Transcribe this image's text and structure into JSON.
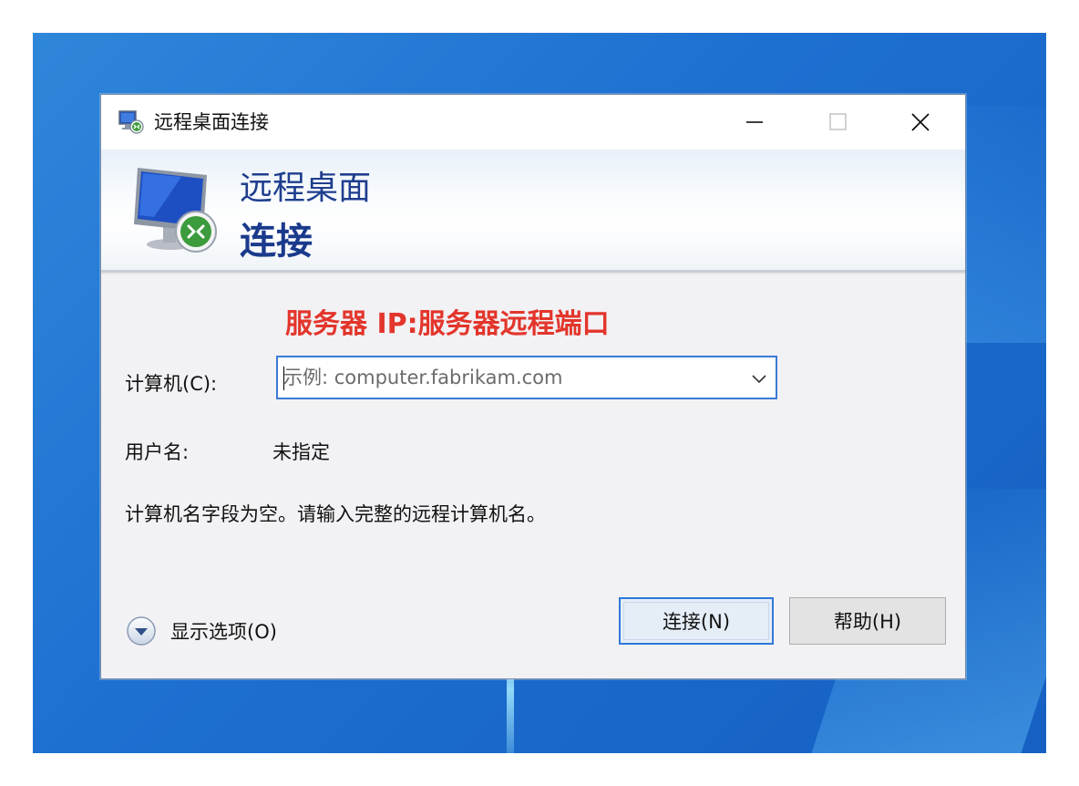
{
  "window": {
    "title": "远程桌面连接",
    "icon": "remote-desktop-icon",
    "controls": {
      "minimize": "minimize-icon",
      "maximize": "maximize-icon",
      "close": "close-icon"
    }
  },
  "banner": {
    "line1": "远程桌面",
    "line2": "连接",
    "icon": "monitor-remote-icon"
  },
  "annotation": {
    "text": "服务器 IP:服务器远程端口",
    "color": "#e3352b"
  },
  "form": {
    "computer_label": "计算机(C):",
    "computer_placeholder": "示例: computer.fabrikam.com",
    "computer_value": "",
    "username_label": "用户名:",
    "username_value": "未指定",
    "message": "计算机名字段为空。请输入完整的远程计算机名。"
  },
  "footer": {
    "options_label": "显示选项(O)",
    "connect_label": "连接(N)",
    "help_label": "帮助(H)"
  },
  "colors": {
    "accent": "#3b7ad6",
    "banner_title": "#1f3e8e",
    "desktop": "#1d6fd0"
  }
}
